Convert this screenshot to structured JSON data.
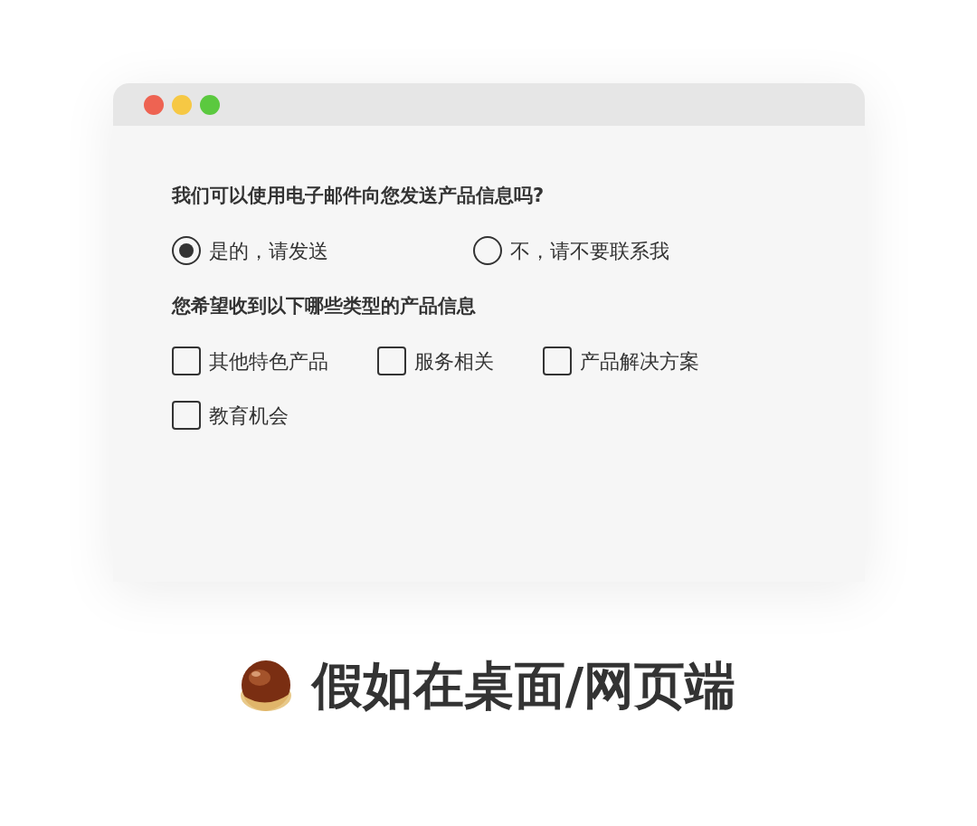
{
  "questions": [
    {
      "kind": "radio",
      "title": "我们可以使用电子邮件向您发送产品信息吗?",
      "options": [
        {
          "label": "是的，请发送",
          "selected": true
        },
        {
          "label": "不，请不要联系我",
          "selected": false
        }
      ]
    },
    {
      "kind": "checkbox",
      "title": "您希望收到以下哪些类型的产品信息",
      "options": [
        {
          "label": "其他特色产品",
          "checked": false
        },
        {
          "label": "服务相关",
          "checked": false
        },
        {
          "label": "产品解决方案",
          "checked": false
        },
        {
          "label": "教育机会",
          "checked": false
        }
      ]
    }
  ],
  "caption": "假如在桌面/网页端"
}
